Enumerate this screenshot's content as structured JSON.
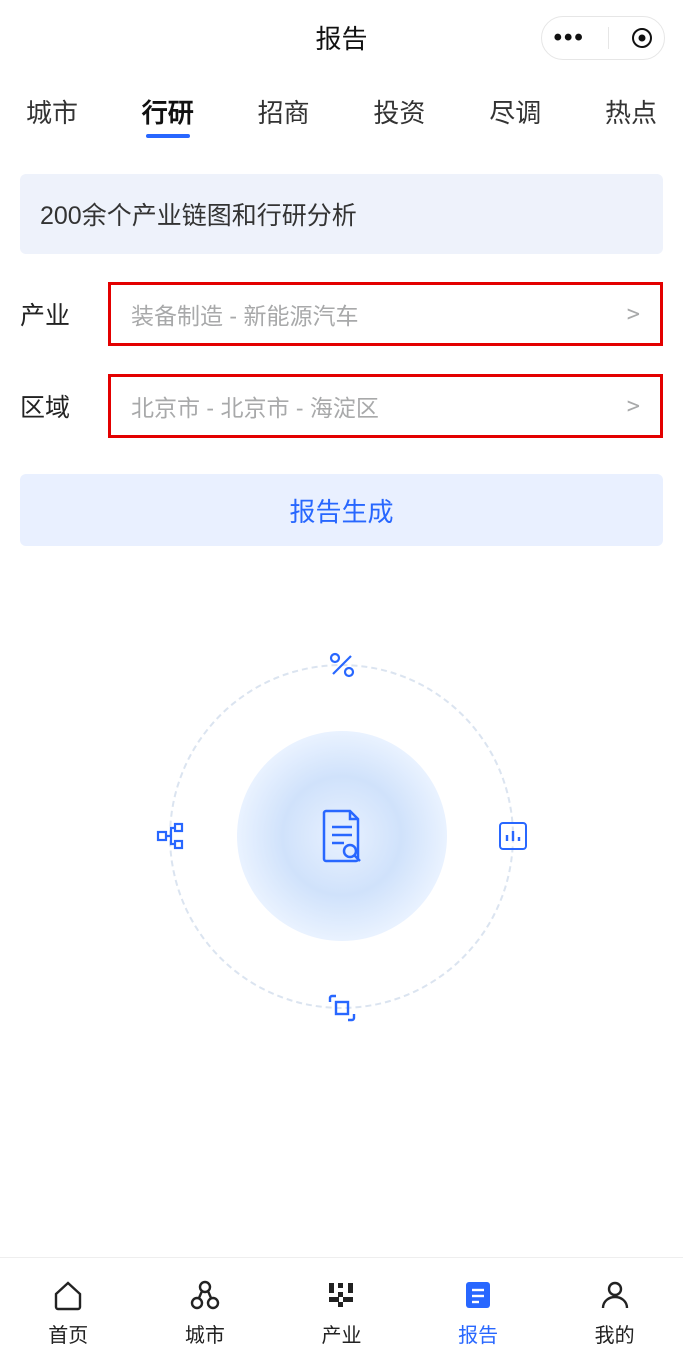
{
  "header": {
    "title": "报告"
  },
  "tabs": {
    "items": [
      "城市",
      "行研",
      "招商",
      "投资",
      "尽调",
      "热点"
    ],
    "activeIndex": 1
  },
  "banner": {
    "text": "200余个产业链图和行研分析"
  },
  "form": {
    "industry": {
      "label": "产业",
      "placeholder": "装备制造 - 新能源汽车"
    },
    "region": {
      "label": "区域",
      "placeholder": "北京市 - 北京市 - 海淀区"
    },
    "generateLabel": "报告生成"
  },
  "bottomNav": {
    "items": [
      {
        "label": "首页"
      },
      {
        "label": "城市"
      },
      {
        "label": "产业"
      },
      {
        "label": "报告"
      },
      {
        "label": "我的"
      }
    ],
    "activeIndex": 3
  }
}
